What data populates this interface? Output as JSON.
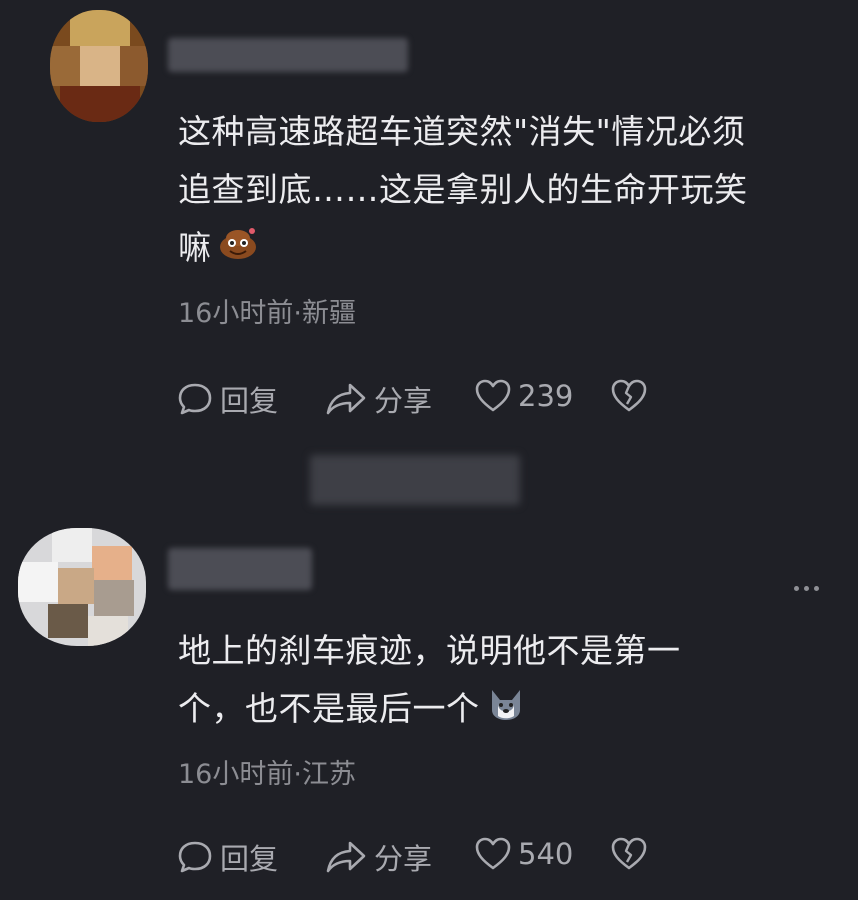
{
  "comments": [
    {
      "text_lines": [
        "这种高速路超车道突然\"消失\"情况必须",
        "追查到底……这是拿别人的生命开玩笑",
        "嘛"
      ],
      "emoji_icon": "poop-face-emoji-icon",
      "meta": "16小时前·新疆",
      "actions": {
        "reply": "回复",
        "share": "分享",
        "like_count": "239"
      }
    },
    {
      "text_lines": [
        "地上的刹车痕迹，说明他不是第一",
        "个，也不是最后一个"
      ],
      "emoji_icon": "husky-dog-emoji-icon",
      "meta": "16小时前·江苏",
      "actions": {
        "reply": "回复",
        "share": "分享",
        "like_count": "540"
      }
    }
  ],
  "colors": {
    "background": "#1f2026",
    "text": "#ececef",
    "meta": "#8c8d93",
    "action": "#a9aab0"
  }
}
